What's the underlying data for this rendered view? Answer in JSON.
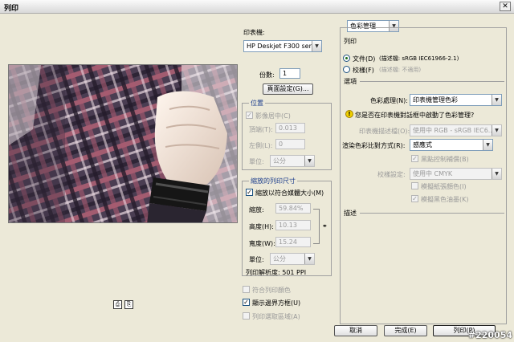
{
  "window": {
    "title": "列印",
    "close": "✕"
  },
  "preview_icons": [
    "⎙",
    "⎘"
  ],
  "printer": {
    "label": "印表機:",
    "value": "HP Deskjet F300 ser..."
  },
  "copies": {
    "label": "份數:",
    "value": "1"
  },
  "page_setup": "頁面設定(G)...",
  "position": {
    "title": "位置",
    "center_label": "影像居中(C)",
    "top_label": "頂端(T):",
    "top_value": "0.013",
    "left_label": "左側(L):",
    "left_value": "0",
    "unit_label": "單位:",
    "unit_value": "公分"
  },
  "scaled": {
    "title": "縮放的列印尺寸",
    "fit_label": "縮放以符合媒體大小(M)",
    "scale_label": "縮放:",
    "scale_value": "59.84%",
    "height_label": "高度(H):",
    "height_value": "10.13",
    "width_label": "寬度(W):",
    "width_value": "15.24",
    "unit_label": "單位:",
    "unit_value": "公分",
    "resolution": "列印解析度: 501 PPI"
  },
  "options": {
    "match_colors": "符合列印顏色",
    "show_bbox": "顯示邊界方框(U)",
    "print_selected": "列印選取區域(A)"
  },
  "right": {
    "mode_select": "色彩管理",
    "print_header": "列印",
    "doc_label": "文件(D)",
    "doc_profile": "(描述檔: sRGB IEC61966-2.1)",
    "proof_label": "校樣(F)",
    "proof_profile": "(描述檔: 不適用)",
    "options_header": "選項",
    "color_handling_label": "色彩處理(N):",
    "color_handling_value": "印表機管理色彩",
    "warning": "您是否在印表機對話框中啟動了色彩管理?",
    "printer_profile_label": "印表機描述檔(O):",
    "printer_profile_value": "使用中 RGB - sRGB IEC6...",
    "intent_label": "渲染色彩比對方式(R):",
    "intent_value": "感應式",
    "bpc_label": "黑點控制補償(B)",
    "proof_setup_label": "校樣設定:",
    "proof_setup_value": "使用中 CMYK",
    "sim_paper": "模擬紙張顏色(I)",
    "sim_black": "模擬黑色油墨(K)",
    "desc_header": "描述"
  },
  "buttons": {
    "cancel": "取消",
    "done": "完成(E)",
    "print": "列印(P)"
  },
  "watermark": "#220054"
}
